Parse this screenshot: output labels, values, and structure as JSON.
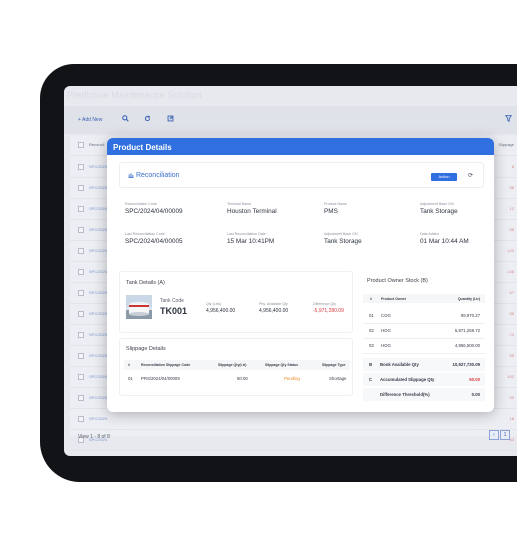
{
  "app": {
    "title": "Predictive Maintenance Solution"
  },
  "toolbar": {
    "add_label": "+ Add New"
  },
  "list": {
    "header_code": "Reconcil",
    "header_right": "Slippage",
    "rows": [
      {
        "code": "SPC/2024",
        "right": "8"
      },
      {
        "code": "SPC/2024",
        "right": "86"
      },
      {
        "code": "SPC/2024",
        "right": "12"
      },
      {
        "code": "SPC/2024",
        "right": "88"
      },
      {
        "code": "SPC/2024",
        "right": "120"
      },
      {
        "code": "SPC/2024",
        "right": "148"
      },
      {
        "code": "SPC/2024",
        "right": "67"
      },
      {
        "code": "SPC/2024",
        "right": "88"
      },
      {
        "code": "SPC/2024",
        "right": "74"
      },
      {
        "code": "SPC/2024",
        "right": "55"
      },
      {
        "code": "SPC/2024",
        "right": "102"
      },
      {
        "code": "SPC/2024",
        "right": "90"
      },
      {
        "code": "SPC/2024",
        "right": "18"
      },
      {
        "code": "SPC/2024",
        "right": "43"
      }
    ],
    "footer": "View 1 - 8 of 8"
  },
  "modal": {
    "title": "Product Details",
    "section_title": "Reconciliation",
    "action_label": "Action",
    "fields": [
      {
        "label": "Reconciliation Code",
        "value": "SPC/2024/04/00009"
      },
      {
        "label": "Terminal Name",
        "value": "Houston Terminal"
      },
      {
        "label": "Product Name",
        "value": "PMS"
      },
      {
        "label": "Adjustment Base ON",
        "value": "Tank Storage"
      },
      {
        "label": "Last Reconciliation Code",
        "value": "SPC/2024/04/00005"
      },
      {
        "label": "Last Reconciliation Date",
        "value": "15 Mar 10:41PM"
      },
      {
        "label": "Adjustment Base ON",
        "value": "Tank Storage"
      },
      {
        "label": "Date Added",
        "value": "01 Mar 10:44 AM"
      }
    ],
    "tank": {
      "title": "Tank Details (A)",
      "code_label": "Tank Code",
      "code_value": "TK001",
      "metrics": [
        {
          "label": "Qty (Ltrs)",
          "value": "4,956,400.00"
        },
        {
          "label": "Phy. Available Qty",
          "value": "4,956,400.00"
        },
        {
          "label": "Difference Qty",
          "value": "-5,971,280.09"
        }
      ]
    },
    "slippage": {
      "title": "Slippage Details",
      "headers": [
        "#",
        "Reconciliation Slippage Code",
        "Slippage Qty(Ltr)",
        "Slippage Qty Status",
        "Slippage Type"
      ],
      "rows": [
        {
          "no": "01",
          "code": "PRS/2024/04/00009",
          "qty": "50.00",
          "status": "Pending",
          "type": "Shortage"
        }
      ]
    },
    "owner": {
      "title": "Product Owner Stock (B)",
      "headers": [
        "#",
        "Product Owner",
        "Quantity (Ltr)"
      ],
      "rows": [
        {
          "no": "01",
          "owner": "COG",
          "qty": "99,970.27"
        },
        {
          "no": "02",
          "owner": "HOG",
          "qty": "5,871,259.72"
        },
        {
          "no": "03",
          "owner": "HOG",
          "qty": "4,956,500.00"
        }
      ],
      "summary": [
        {
          "key": "B",
          "label": "Book Available Qty",
          "value": "10,927,730.09"
        },
        {
          "key": "C",
          "label": "Accumulated Slippage Qty",
          "value": "50.00"
        },
        {
          "key": "",
          "label": "Difference Threshold(%)",
          "value": "0.00"
        }
      ]
    }
  },
  "colors": {
    "accent": "#2f6fe0",
    "negative": "#d9393f",
    "pending": "#e58a1e"
  }
}
